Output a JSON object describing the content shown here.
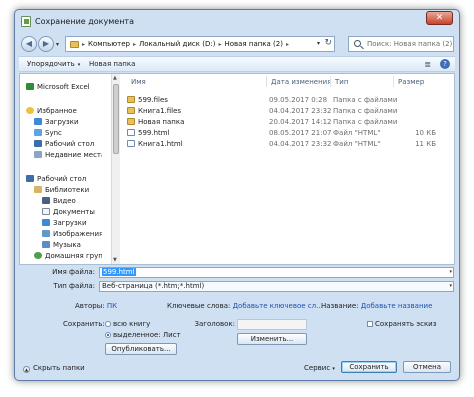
{
  "window": {
    "title": "Сохранение документа",
    "close": "✕"
  },
  "nav": {
    "back": "◀",
    "forward": "▶",
    "dropdown": "▾",
    "breadcrumbs": [
      "Компьютер",
      "Локальный диск (D:)",
      "Новая папка (2)"
    ],
    "crumb_sep": "▸",
    "refresh": "↻",
    "search_placeholder": "Поиск: Новая папка (2)"
  },
  "toolbar": {
    "organize": "Упорядочить",
    "new_folder": "Новая папка",
    "view_icon": "≣",
    "help": "?"
  },
  "sidebar": {
    "items": [
      {
        "label": "Microsoft Excel",
        "icon": "excel-icon"
      },
      {
        "label": "Избранное",
        "icon": "star-icon"
      },
      {
        "label": "Загрузки",
        "icon": "download-icon"
      },
      {
        "label": "Sync",
        "icon": "sync-icon"
      },
      {
        "label": "Рабочий стол",
        "icon": "desktop-icon"
      },
      {
        "label": "Недавние места",
        "icon": "recent-icon"
      },
      {
        "label": "Рабочий стол",
        "icon": "desktop-icon"
      },
      {
        "label": "Библиотеки",
        "icon": "library-icon"
      },
      {
        "label": "Видео",
        "icon": "video-icon"
      },
      {
        "label": "Документы",
        "icon": "documents-icon"
      },
      {
        "label": "Загрузки",
        "icon": "download-icon"
      },
      {
        "label": "Изображения",
        "icon": "images-icon"
      },
      {
        "label": "Музыка",
        "icon": "music-icon"
      },
      {
        "label": "Домашняя груп",
        "icon": "homegroup-icon"
      }
    ]
  },
  "files": {
    "columns": {
      "name": "Имя",
      "date": "Дата изменения",
      "type": "Тип",
      "size": "Размер"
    },
    "rows": [
      {
        "name": "599.files",
        "date": "09.05.2017 0:28",
        "type": "Папка с файлами",
        "size": "",
        "icon": "folder-icon"
      },
      {
        "name": "Книга1.files",
        "date": "04.04.2017 23:32",
        "type": "Папка с файлами",
        "size": "",
        "icon": "folder-icon"
      },
      {
        "name": "Новая папка",
        "date": "20.04.2017 14:12",
        "type": "Папка с файлами",
        "size": "",
        "icon": "folder-icon"
      },
      {
        "name": "599.html",
        "date": "08.05.2017 21:07",
        "type": "Файл \"HTML\"",
        "size": "10 КБ",
        "icon": "html-file-icon"
      },
      {
        "name": "Книга1.html",
        "date": "04.04.2017 23:32",
        "type": "Файл \"HTML\"",
        "size": "11 КБ",
        "icon": "html-file-icon"
      }
    ]
  },
  "form": {
    "filename_label": "Имя файла:",
    "filename_value": "599.html",
    "filetype_label": "Тип файла:",
    "filetype_value": "Веб-страница (*.htm;*.html)",
    "authors_label": "Авторы:",
    "authors_value": "ПК",
    "keywords_label": "Ключевые слова:",
    "keywords_value": "Добавьте ключевое сл...",
    "title_label": "Название:",
    "title_value": "Добавьте название",
    "save_label": "Сохранить:",
    "radio_book": "всю книгу",
    "radio_selection": "выделенное: Лист",
    "publish": "Опубликовать...",
    "heading_label": "Заголовок:",
    "change": "Изменить...",
    "save_thumbnail": "Сохранять эскиз"
  },
  "footer": {
    "hide_folders": "Скрыть папки",
    "service": "Сервис",
    "save": "Сохранить",
    "cancel": "Отмена"
  }
}
